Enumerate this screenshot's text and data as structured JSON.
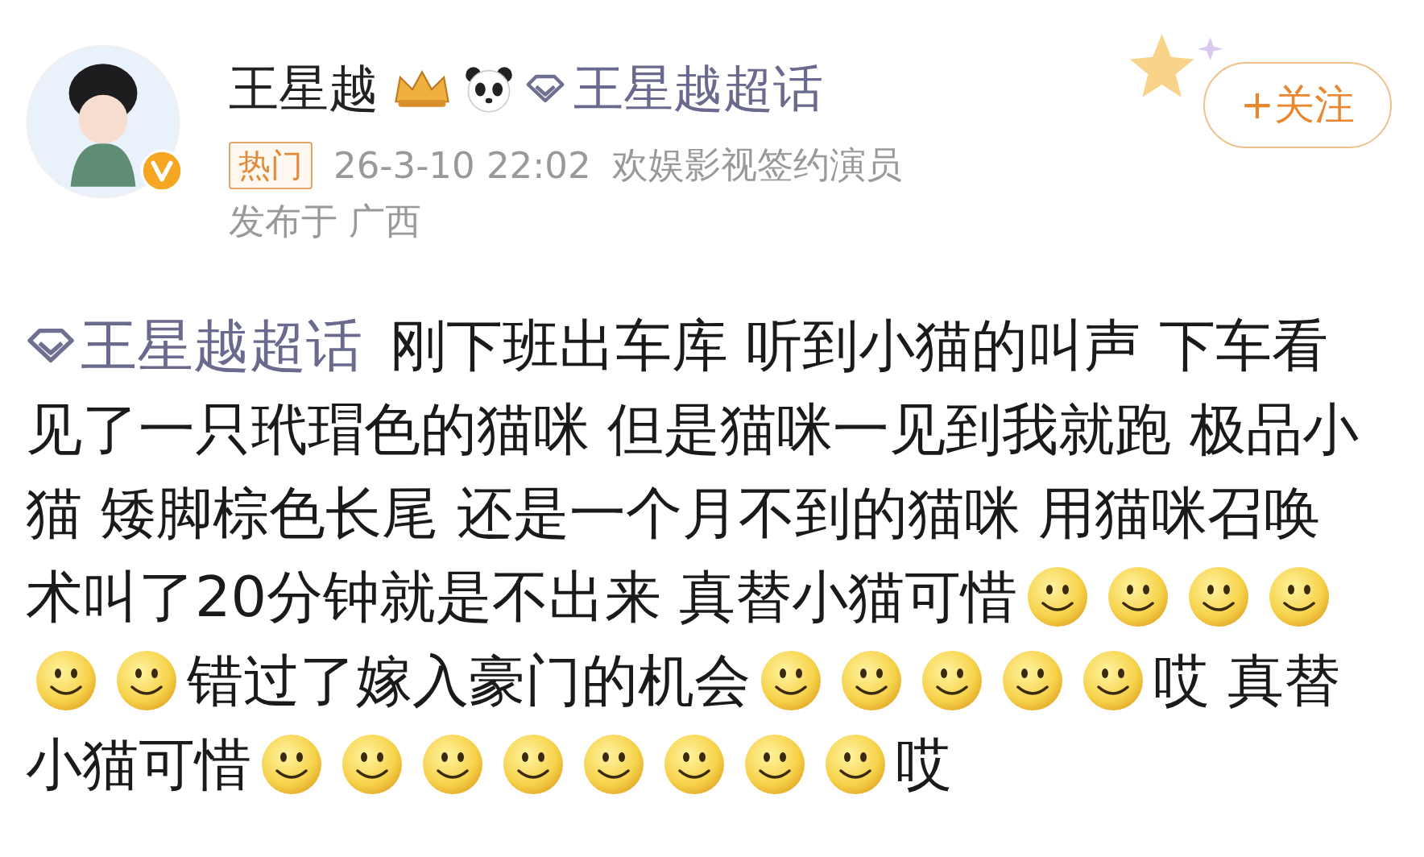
{
  "author": {
    "name": "王星越",
    "verified": true,
    "topic": "王星越超话"
  },
  "follow_button": "+关注",
  "meta": {
    "tag": "热门",
    "time": "26-3-10 22:02",
    "source": "欢娱影视签约演员",
    "location": "发布于 广西"
  },
  "body_lines": [
    [
      {
        "kind": "topic",
        "text": "王星越超话"
      },
      {
        "kind": "text",
        "text": "刚下班出车库 听到小猫的叫声 下车看"
      }
    ],
    [
      {
        "kind": "text",
        "text": "见了一只玳瑁色的猫咪 但是猫咪一见到我就跑 极品小"
      }
    ],
    [
      {
        "kind": "text",
        "text": "猫 矮脚棕色长尾 还是一个月不到的猫咪 用猫咪召唤"
      }
    ],
    [
      {
        "kind": "text",
        "text": "术叫了20分钟就是不出来 真替小猫可惜"
      },
      {
        "kind": "emoji"
      },
      {
        "kind": "emoji"
      },
      {
        "kind": "emoji"
      },
      {
        "kind": "emoji"
      }
    ],
    [
      {
        "kind": "emoji"
      },
      {
        "kind": "emoji"
      },
      {
        "kind": "text",
        "text": "错过了嫁入豪门的机会"
      },
      {
        "kind": "emoji"
      },
      {
        "kind": "emoji"
      },
      {
        "kind": "emoji"
      },
      {
        "kind": "emoji"
      },
      {
        "kind": "emoji"
      },
      {
        "kind": "text",
        "text": "哎 真替"
      }
    ],
    [
      {
        "kind": "text",
        "text": "小猫可惜"
      },
      {
        "kind": "emoji"
      },
      {
        "kind": "emoji"
      },
      {
        "kind": "emoji"
      },
      {
        "kind": "emoji"
      },
      {
        "kind": "emoji"
      },
      {
        "kind": "emoji"
      },
      {
        "kind": "emoji"
      },
      {
        "kind": "emoji"
      },
      {
        "kind": "text",
        "text": "哎"
      }
    ]
  ]
}
